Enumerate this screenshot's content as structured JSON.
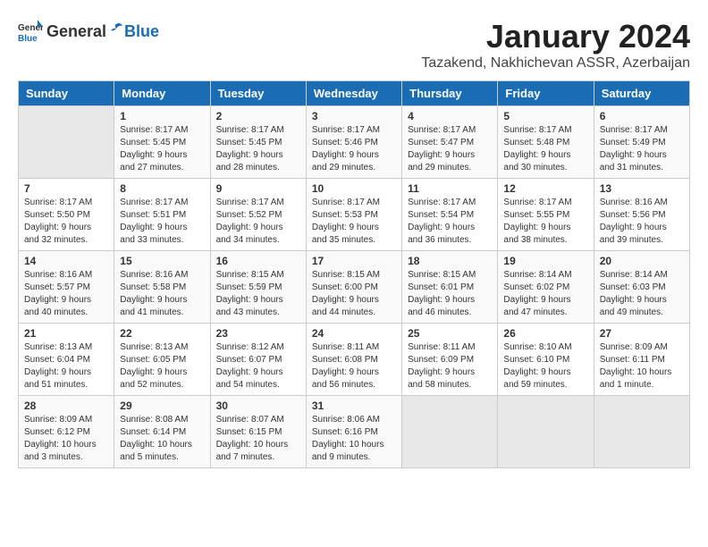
{
  "logo": {
    "general": "General",
    "blue": "Blue"
  },
  "title": "January 2024",
  "subtitle": "Tazakend, Nakhichevan ASSR, Azerbaijan",
  "headers": [
    "Sunday",
    "Monday",
    "Tuesday",
    "Wednesday",
    "Thursday",
    "Friday",
    "Saturday"
  ],
  "weeks": [
    [
      {
        "day": "",
        "info": ""
      },
      {
        "day": "1",
        "info": "Sunrise: 8:17 AM\nSunset: 5:45 PM\nDaylight: 9 hours\nand 27 minutes."
      },
      {
        "day": "2",
        "info": "Sunrise: 8:17 AM\nSunset: 5:45 PM\nDaylight: 9 hours\nand 28 minutes."
      },
      {
        "day": "3",
        "info": "Sunrise: 8:17 AM\nSunset: 5:46 PM\nDaylight: 9 hours\nand 29 minutes."
      },
      {
        "day": "4",
        "info": "Sunrise: 8:17 AM\nSunset: 5:47 PM\nDaylight: 9 hours\nand 29 minutes."
      },
      {
        "day": "5",
        "info": "Sunrise: 8:17 AM\nSunset: 5:48 PM\nDaylight: 9 hours\nand 30 minutes."
      },
      {
        "day": "6",
        "info": "Sunrise: 8:17 AM\nSunset: 5:49 PM\nDaylight: 9 hours\nand 31 minutes."
      }
    ],
    [
      {
        "day": "7",
        "info": "Sunrise: 8:17 AM\nSunset: 5:50 PM\nDaylight: 9 hours\nand 32 minutes."
      },
      {
        "day": "8",
        "info": "Sunrise: 8:17 AM\nSunset: 5:51 PM\nDaylight: 9 hours\nand 33 minutes."
      },
      {
        "day": "9",
        "info": "Sunrise: 8:17 AM\nSunset: 5:52 PM\nDaylight: 9 hours\nand 34 minutes."
      },
      {
        "day": "10",
        "info": "Sunrise: 8:17 AM\nSunset: 5:53 PM\nDaylight: 9 hours\nand 35 minutes."
      },
      {
        "day": "11",
        "info": "Sunrise: 8:17 AM\nSunset: 5:54 PM\nDaylight: 9 hours\nand 36 minutes."
      },
      {
        "day": "12",
        "info": "Sunrise: 8:17 AM\nSunset: 5:55 PM\nDaylight: 9 hours\nand 38 minutes."
      },
      {
        "day": "13",
        "info": "Sunrise: 8:16 AM\nSunset: 5:56 PM\nDaylight: 9 hours\nand 39 minutes."
      }
    ],
    [
      {
        "day": "14",
        "info": "Sunrise: 8:16 AM\nSunset: 5:57 PM\nDaylight: 9 hours\nand 40 minutes."
      },
      {
        "day": "15",
        "info": "Sunrise: 8:16 AM\nSunset: 5:58 PM\nDaylight: 9 hours\nand 41 minutes."
      },
      {
        "day": "16",
        "info": "Sunrise: 8:15 AM\nSunset: 5:59 PM\nDaylight: 9 hours\nand 43 minutes."
      },
      {
        "day": "17",
        "info": "Sunrise: 8:15 AM\nSunset: 6:00 PM\nDaylight: 9 hours\nand 44 minutes."
      },
      {
        "day": "18",
        "info": "Sunrise: 8:15 AM\nSunset: 6:01 PM\nDaylight: 9 hours\nand 46 minutes."
      },
      {
        "day": "19",
        "info": "Sunrise: 8:14 AM\nSunset: 6:02 PM\nDaylight: 9 hours\nand 47 minutes."
      },
      {
        "day": "20",
        "info": "Sunrise: 8:14 AM\nSunset: 6:03 PM\nDaylight: 9 hours\nand 49 minutes."
      }
    ],
    [
      {
        "day": "21",
        "info": "Sunrise: 8:13 AM\nSunset: 6:04 PM\nDaylight: 9 hours\nand 51 minutes."
      },
      {
        "day": "22",
        "info": "Sunrise: 8:13 AM\nSunset: 6:05 PM\nDaylight: 9 hours\nand 52 minutes."
      },
      {
        "day": "23",
        "info": "Sunrise: 8:12 AM\nSunset: 6:07 PM\nDaylight: 9 hours\nand 54 minutes."
      },
      {
        "day": "24",
        "info": "Sunrise: 8:11 AM\nSunset: 6:08 PM\nDaylight: 9 hours\nand 56 minutes."
      },
      {
        "day": "25",
        "info": "Sunrise: 8:11 AM\nSunset: 6:09 PM\nDaylight: 9 hours\nand 58 minutes."
      },
      {
        "day": "26",
        "info": "Sunrise: 8:10 AM\nSunset: 6:10 PM\nDaylight: 9 hours\nand 59 minutes."
      },
      {
        "day": "27",
        "info": "Sunrise: 8:09 AM\nSunset: 6:11 PM\nDaylight: 10 hours\nand 1 minute."
      }
    ],
    [
      {
        "day": "28",
        "info": "Sunrise: 8:09 AM\nSunset: 6:12 PM\nDaylight: 10 hours\nand 3 minutes."
      },
      {
        "day": "29",
        "info": "Sunrise: 8:08 AM\nSunset: 6:14 PM\nDaylight: 10 hours\nand 5 minutes."
      },
      {
        "day": "30",
        "info": "Sunrise: 8:07 AM\nSunset: 6:15 PM\nDaylight: 10 hours\nand 7 minutes."
      },
      {
        "day": "31",
        "info": "Sunrise: 8:06 AM\nSunset: 6:16 PM\nDaylight: 10 hours\nand 9 minutes."
      },
      {
        "day": "",
        "info": ""
      },
      {
        "day": "",
        "info": ""
      },
      {
        "day": "",
        "info": ""
      }
    ]
  ]
}
